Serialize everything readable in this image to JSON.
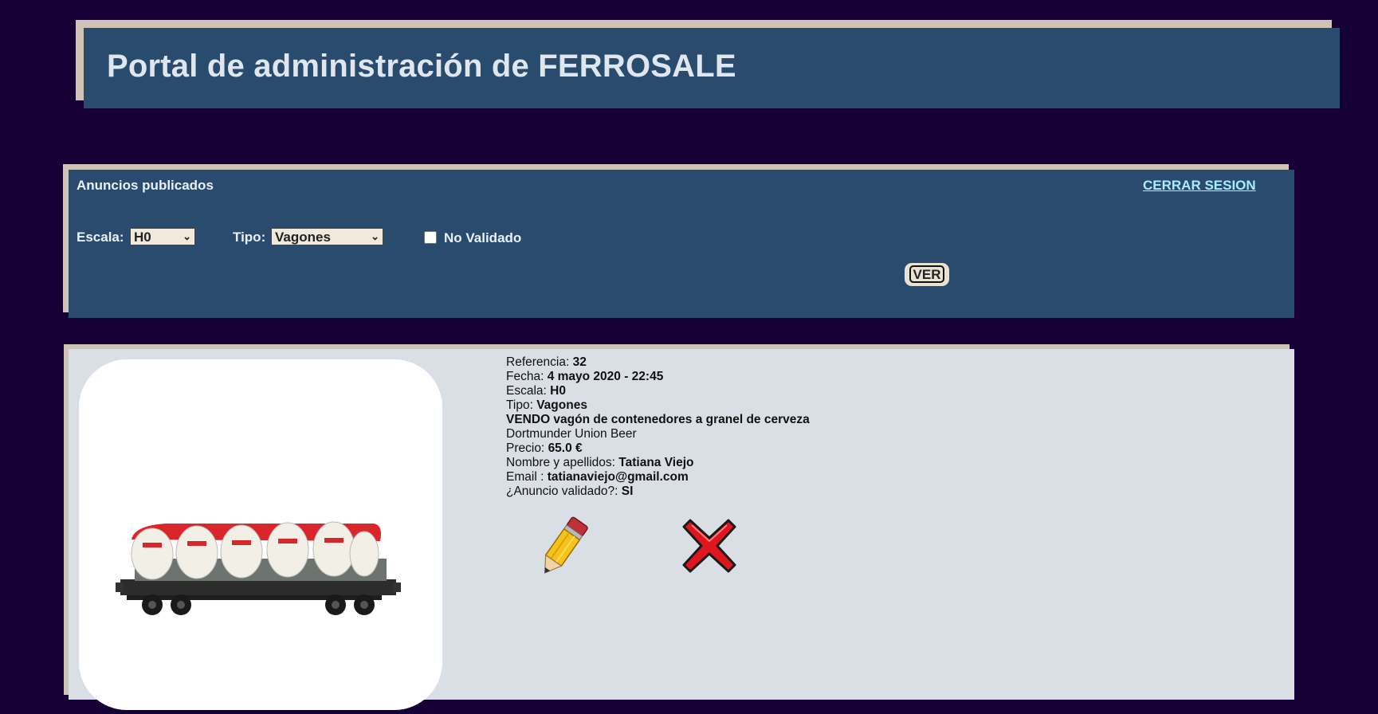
{
  "header": {
    "title": "Portal de administración de FERROSALE"
  },
  "filter_panel": {
    "title": "Anuncios publicados",
    "logout_label": "CERRAR SESION",
    "scale_label": "Escala:",
    "scale_value": "H0",
    "type_label": "Tipo:",
    "type_value": "Vagones",
    "not_validated_label": "No Validado",
    "not_validated_checked": false,
    "view_button_label": "VER"
  },
  "listing": {
    "ref_label": "Referencia:",
    "ref_value": "32",
    "date_label": "Fecha:",
    "date_value": "4 mayo 2020 - 22:45",
    "scale_label": "Escala:",
    "scale_value": "H0",
    "type_label": "Tipo:",
    "type_value": "Vagones",
    "headline": "VENDO vagón de contenedores a granel de cerveza",
    "description": "Dortmunder Union Beer",
    "price_label": "Precio:",
    "price_value": "65.0 €",
    "name_label": "Nombre y apellidos:",
    "name_value": "Tatiana Viejo",
    "email_label": "Email :",
    "email_value": "tatianaviejo@gmail.com",
    "validated_label": "¿Anuncio validado?:",
    "validated_value": "SI"
  },
  "icons": {
    "edit": "pencil-icon",
    "delete": "red-x-icon"
  },
  "colors": {
    "background": "#150035",
    "panel": "#284b6e",
    "card": "#d9dfe5",
    "link": "#a8ecff"
  }
}
